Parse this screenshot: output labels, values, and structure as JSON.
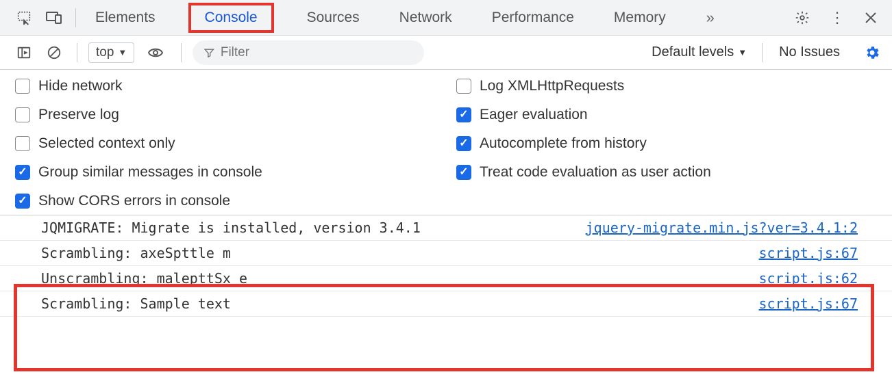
{
  "tabs": [
    "Elements",
    "Console",
    "Sources",
    "Network",
    "Performance",
    "Memory"
  ],
  "active_tab_index": 1,
  "filterbar": {
    "context": "top",
    "filter_placeholder": "Filter",
    "levels_label": "Default levels",
    "issues_label": "No Issues"
  },
  "settings": {
    "left": [
      {
        "label": "Hide network",
        "checked": false
      },
      {
        "label": "Preserve log",
        "checked": false
      },
      {
        "label": "Selected context only",
        "checked": false
      },
      {
        "label": "Group similar messages in console",
        "checked": true
      },
      {
        "label": "Show CORS errors in console",
        "checked": true
      }
    ],
    "right": [
      {
        "label": "Log XMLHttpRequests",
        "checked": false
      },
      {
        "label": "Eager evaluation",
        "checked": true
      },
      {
        "label": "Autocomplete from history",
        "checked": true
      },
      {
        "label": "Treat code evaluation as user action",
        "checked": true
      }
    ]
  },
  "log": [
    {
      "message": "JQMIGRATE: Migrate is installed, version 3.4.1",
      "source": "jquery-migrate.min.js?ver=3.4.1:2"
    },
    {
      "message": "Scrambling: axeSpttle m",
      "source": "script.js:67"
    },
    {
      "message": "Unscrambling: malepttSx e",
      "source": "script.js:62"
    },
    {
      "message": "Scrambling: Sample text",
      "source": "script.js:67"
    }
  ]
}
